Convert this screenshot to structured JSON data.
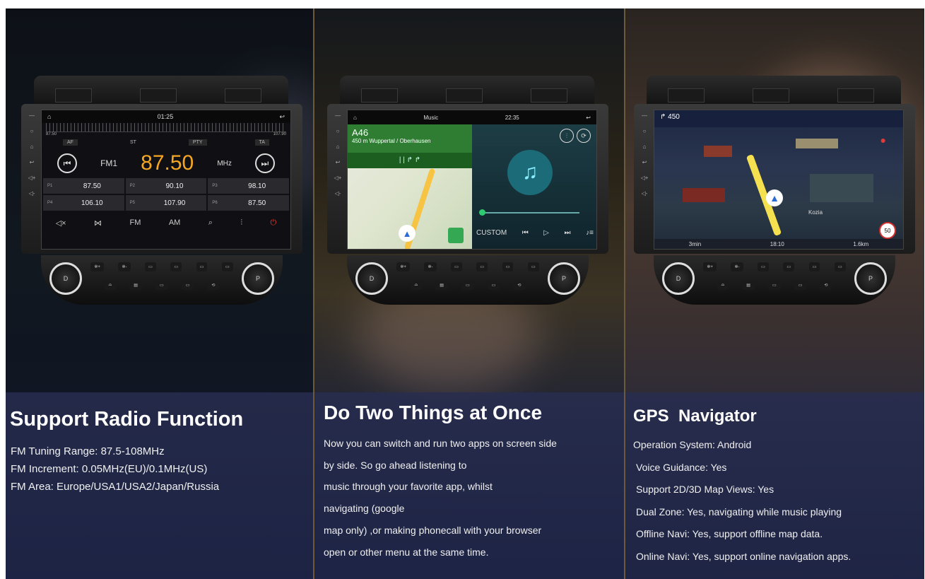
{
  "colors": {
    "radio_frequency": "#f5a623",
    "nav_green": "#2e7d32",
    "route_yellow": "#f5e050",
    "power_red": "#e53935",
    "heading_text": "#ffffff"
  },
  "radio": {
    "heading": "Support Radio Function",
    "lines": [
      "FM Tuning Range: 87.5-108MHz",
      "FM Increment: 0.05MHz(EU)/0.1MHz(US)",
      "FM Area: Europe/USA1/USA2/Japan/Russia"
    ],
    "screen": {
      "time": "01:25",
      "scale_start": "87.50",
      "scale_end": "107.90",
      "tags": [
        "AF",
        "ST",
        "PTY",
        "TA"
      ],
      "band": "FM1",
      "frequency": "87.50",
      "unit": "MHz",
      "presets": [
        {
          "slot": "P1",
          "freq": "87.50"
        },
        {
          "slot": "P2",
          "freq": "90.10"
        },
        {
          "slot": "P3",
          "freq": "98.10"
        },
        {
          "slot": "P4",
          "freq": "106.10"
        },
        {
          "slot": "P5",
          "freq": "107.90"
        },
        {
          "slot": "P6",
          "freq": "87.50"
        }
      ],
      "controls": [
        "FM",
        "AM"
      ]
    }
  },
  "split": {
    "heading": "Do Two Things at Once",
    "lines": [
      "Now you can switch and run two apps on screen side",
      "by side. So go ahead listening to",
      "music through your favorite app, whilst",
      "navigating (google",
      "map only) ,or making phonecall with your browser",
      "open or other menu at the same time."
    ],
    "screen": {
      "app_title": "Music",
      "time": "22:35",
      "road": "A46",
      "distance": "450 m",
      "destination": "Wuppertal / Oberhausen",
      "music_mode": "CUSTOM"
    }
  },
  "gps": {
    "heading": "GPS  Navigator",
    "lines": [
      "Operation System: Android",
      "Voice Guidance: Yes",
      "Support 2D/3D Map Views: Yes",
      "Dual Zone: Yes, navigating while music playing",
      "Offline Navi: Yes, support offline map data.",
      "Online Navi: Yes, support online navigation apps."
    ],
    "screen": {
      "top_distance": "450",
      "eta_duration": "3min",
      "arrival_time": "18:10",
      "remaining": "1.6km",
      "street": "Kozia",
      "speed_limit": "50"
    }
  }
}
